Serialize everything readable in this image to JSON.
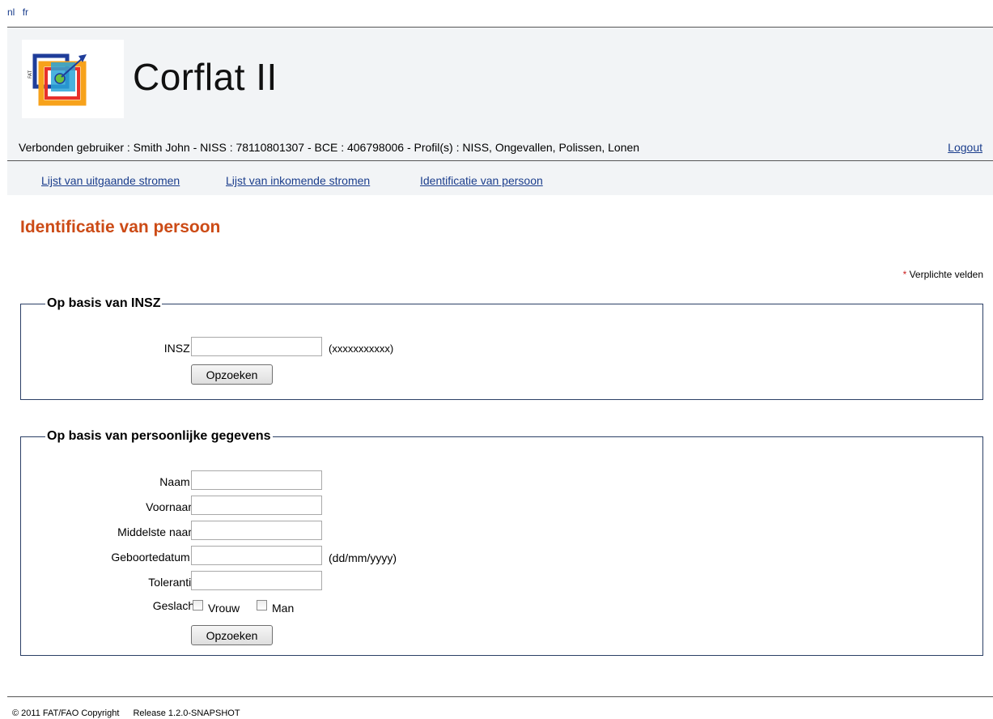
{
  "languages": [
    "nl",
    "fr"
  ],
  "header": {
    "app_title": "Corflat II",
    "logo_text": "FAT"
  },
  "userbar": {
    "info": "Verbonden gebruiker : Smith John - NISS : 78110801307 - BCE : 406798006 - Profil(s) : NISS, Ongevallen, Polissen, Lonen",
    "logout": "Logout"
  },
  "nav": {
    "items": [
      "Lijst van uitgaande stromen",
      "Lijst van inkomende stromen",
      "Identificatie van persoon"
    ]
  },
  "page": {
    "title": "Identificatie van persoon",
    "required_marker": "*",
    "required_note": "Verplichte velden"
  },
  "insz_section": {
    "legend": "Op basis van INSZ",
    "insz_label": "INSZ",
    "insz_value": "",
    "insz_hint": "(xxxxxxxxxxx)",
    "search_button": "Opzoeken"
  },
  "personal_section": {
    "legend": "Op basis van persoonlijke gegevens",
    "fields": {
      "naam": {
        "label": "Naam",
        "value": ""
      },
      "voornaam": {
        "label": "Voornaam",
        "value": ""
      },
      "middelste_naam": {
        "label": "Middelste naam",
        "value": ""
      },
      "geboortedatum": {
        "label": "Geboortedatum",
        "value": "",
        "hint": "(dd/mm/yyyy)"
      },
      "tolerantie": {
        "label": "Tolerantie",
        "value": ""
      }
    },
    "geslacht": {
      "label": "Geslacht",
      "option_female": "Vrouw",
      "option_male": "Man"
    },
    "search_button": "Opzoeken"
  },
  "footer": {
    "copyright": "© 2011 FAT/FAO Copyright",
    "release": "Release 1.2.0-SNAPSHOT"
  },
  "colors": {
    "title": "#cc4b16",
    "link": "#1a3d8c",
    "required": "#cc2222",
    "fieldset_border": "#2b3f66",
    "header_bg": "#f2f4f6"
  }
}
